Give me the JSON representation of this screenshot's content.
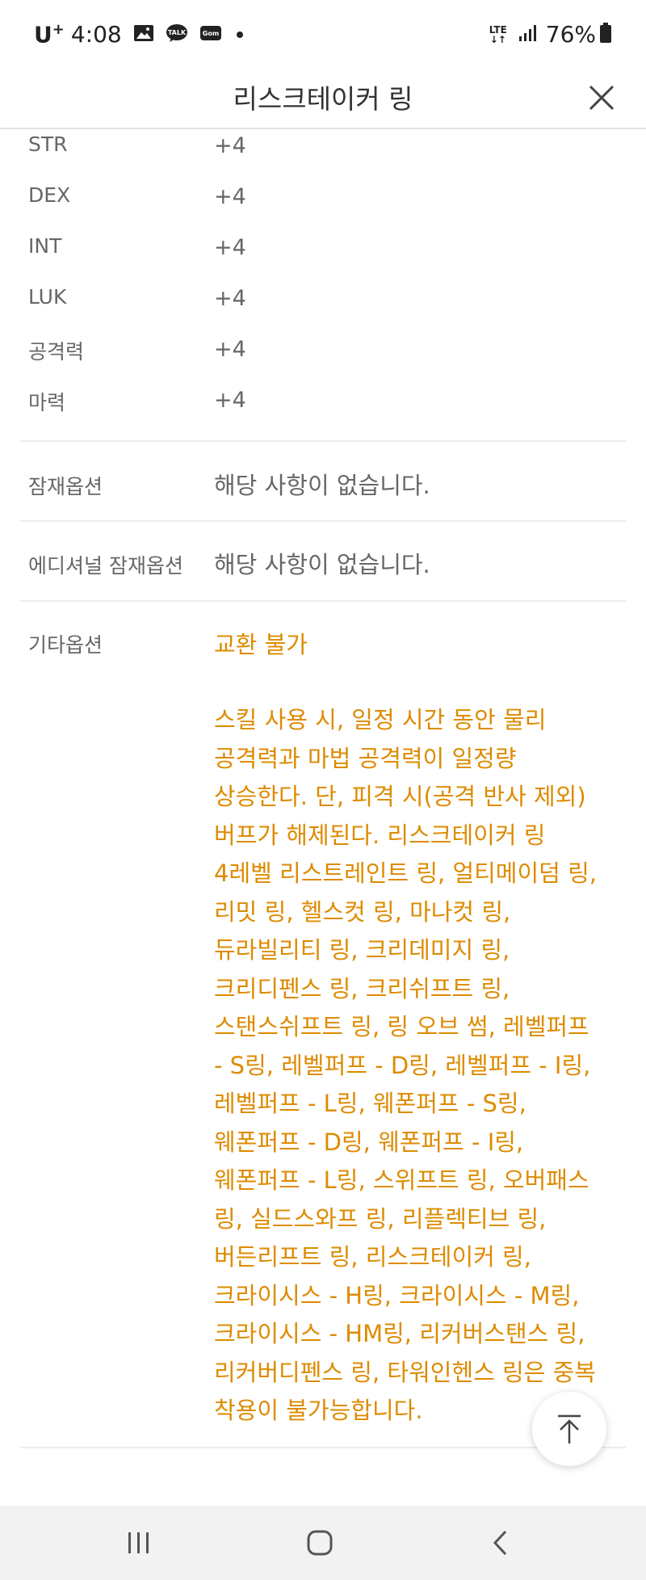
{
  "status_bar": {
    "carrier": "U",
    "carrier_sup": "+",
    "time": "4:08",
    "network": "LTE",
    "battery": "76%"
  },
  "header": {
    "title": "리스크테이커 링"
  },
  "stats": [
    {
      "label": "STR",
      "value": "+4"
    },
    {
      "label": "DEX",
      "value": "+4"
    },
    {
      "label": "INT",
      "value": "+4"
    },
    {
      "label": "LUK",
      "value": "+4"
    },
    {
      "label": "공격력",
      "value": "+4"
    },
    {
      "label": "마력",
      "value": "+4"
    }
  ],
  "potential": {
    "label": "잠재옵션",
    "value": "해당 사항이 없습니다."
  },
  "additional_potential": {
    "label": "에디셔널 잠재옵션",
    "value": "해당 사항이 없습니다."
  },
  "etc_options": {
    "label": "기타옵션",
    "trade": "교환 불가",
    "description": "스킬 사용 시, 일정 시간 동안 물리\n공격력과 마법 공격력이 일정량\n상승한다. 단, 피격 시(공격 반사 제외)\n버프가 해제된다. 리스크테이커 링\n4레벨 리스트레인트 링, 얼티메이덤 링,\n리밋 링, 헬스컷 링, 마나컷 링,\n듀라빌리티 링, 크리데미지 링,\n크리디펜스 링, 크리쉬프트 링,\n스탠스쉬프트 링, 링 오브 썸, 레벨퍼프\n- S링, 레벨퍼프 - D링, 레벨퍼프 - I링,\n레벨퍼프 - L링, 웨폰퍼프 - S링,\n웨폰퍼프 - D링, 웨폰퍼프 - I링,\n웨폰퍼프 - L링, 스위프트 링, 오버패스\n링, 실드스와프 링, 리플렉티브 링,\n버든리프트 링, 리스크테이커 링,\n크라이시스 - H링, 크라이시스 - M링,\n크라이시스 - HM링, 리커버스탠스 링,\n리커버디펜스 링, 타워인헨스 링은 중복\n착용이 불가능합니다."
  },
  "colors": {
    "accent_orange": "#dd8b00",
    "label_gray": "#666666",
    "divider": "#ececec"
  }
}
